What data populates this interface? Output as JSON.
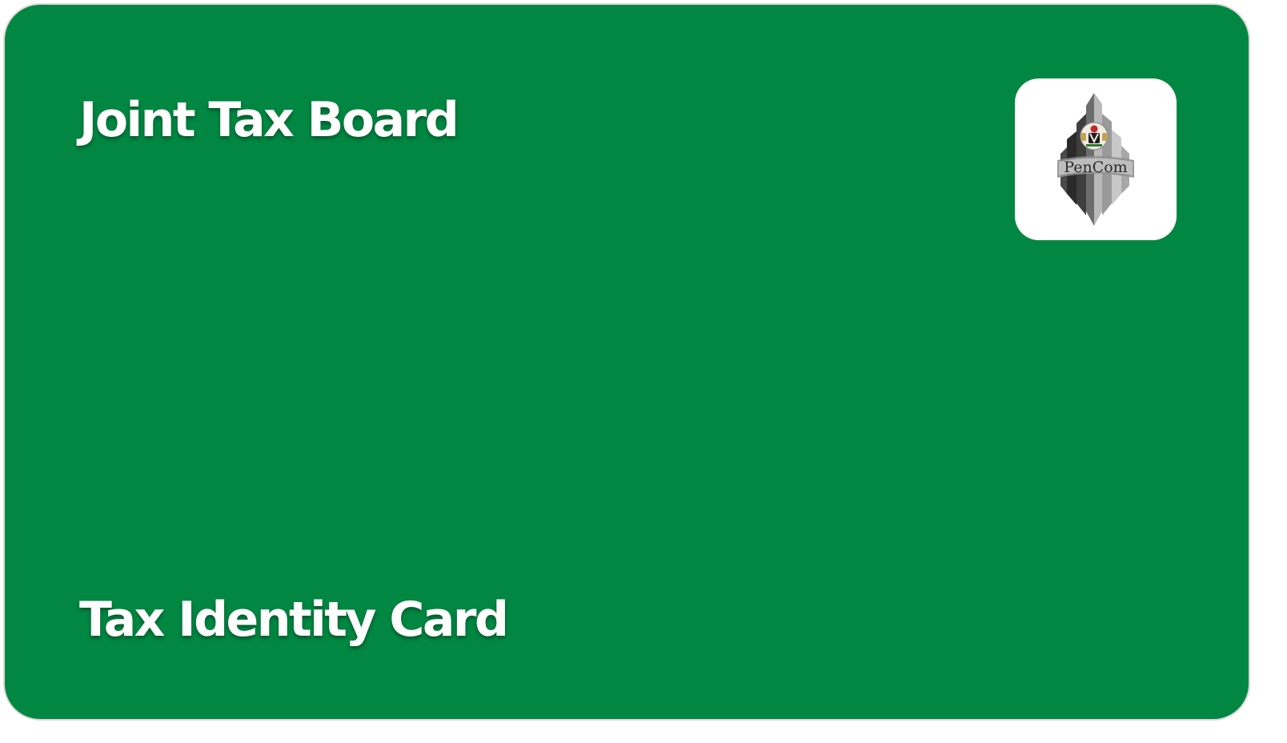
{
  "card": {
    "title": "Joint Tax Board",
    "subtitle": "Tax Identity Card",
    "background_color": "#018742",
    "text_color": "#ffffff"
  },
  "logo": {
    "icon": "pencom-logo-icon",
    "text": "PenCom",
    "tile_color": "#ffffff"
  }
}
